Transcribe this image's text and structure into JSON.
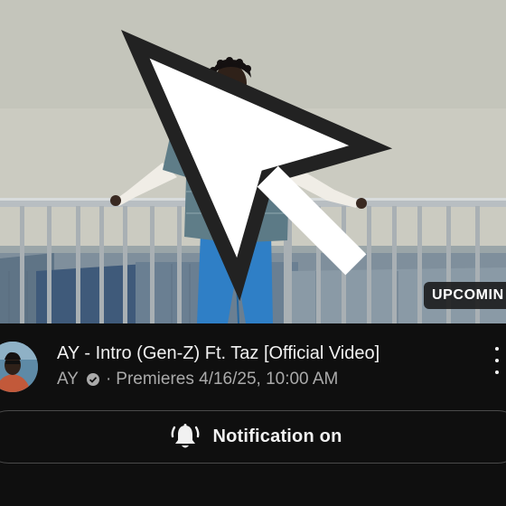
{
  "video": {
    "badge_label": "UPCOMIN",
    "title": "AY - Intro (Gen-Z) Ft. Taz [Official Video]",
    "channel": "AY",
    "separator": "·",
    "premiere_text": "Premieres 4/16/25, 10:00 AM"
  },
  "notification": {
    "label": "Notification on"
  },
  "icons": {
    "cursor": "cursor-icon",
    "verified": "verified-icon",
    "more": "more-vertical-icon",
    "bell": "bell-ringing-icon"
  },
  "colors": {
    "background": "#0f0f0f",
    "primary_text": "#f1f1f1",
    "secondary_text": "#aaaaaa",
    "button_border": "#4a4a4a"
  }
}
